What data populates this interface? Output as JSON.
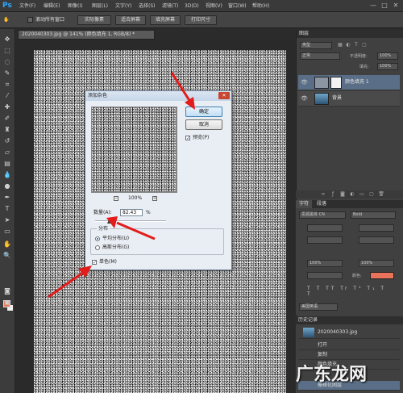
{
  "app": {
    "logo": "Ps",
    "menu": [
      "文件(F)",
      "编辑(E)",
      "图像(I)",
      "图层(L)",
      "文字(Y)",
      "选择(S)",
      "滤镜(T)",
      "3D(D)",
      "视图(V)",
      "窗口(W)",
      "帮助(H)"
    ],
    "window_buttons": [
      "—",
      "□",
      "✕"
    ]
  },
  "options_bar": {
    "scroll_all": "滚动所有窗口",
    "actual_pixels": "实际像素",
    "fit_screen": "适合屏幕",
    "fill_screen": "填充屏幕",
    "print_size": "打印尺寸"
  },
  "document": {
    "tab_title": "2020040303.jpg @ 141% (颜色填充 1, RGB/8) *"
  },
  "dialog": {
    "title": "添加杂色",
    "ok_label": "确定",
    "cancel_label": "取消",
    "preview_label": "预览(P)",
    "preview_checked": true,
    "zoom_minus": "−",
    "zoom_plus": "+",
    "zoom_value": "100%",
    "amount_label": "数量(A):",
    "amount_value": "82.43",
    "amount_unit": "%",
    "amount_fraction": 0.2,
    "distribution_label": "分布",
    "uniform_label": "平均分布(U)",
    "gaussian_label": "高斯分布(G)",
    "distribution_selected": "uniform",
    "monochrome_label": "单色(M)",
    "monochrome_checked": true
  },
  "layers_panel": {
    "title": "图层",
    "filter_label": "类型",
    "blend_mode": "正常",
    "opacity_label": "不透明度:",
    "opacity_value": "100%",
    "fill_label": "填充:",
    "fill_value": "100%",
    "layers": [
      {
        "name": "颜色填充 1",
        "selected": true
      },
      {
        "name": "背景",
        "selected": false
      }
    ]
  },
  "character_panel": {
    "title": "字符",
    "paragraph_tab": "段落",
    "font_family": "思源黑体 CN",
    "font_style": "Bold",
    "scale_v": "100%",
    "scale_h": "100%",
    "color_label": "颜色:",
    "color_value": "#e8735a",
    "language": "美国英语"
  },
  "history_panel": {
    "title": "历史记录",
    "snapshot": "2020040303.jpg",
    "items": [
      "打开",
      "复制",
      "颜色填充",
      "栅格化图层"
    ],
    "selected_index": 3
  },
  "watermark": {
    "text": "广东龙网"
  }
}
